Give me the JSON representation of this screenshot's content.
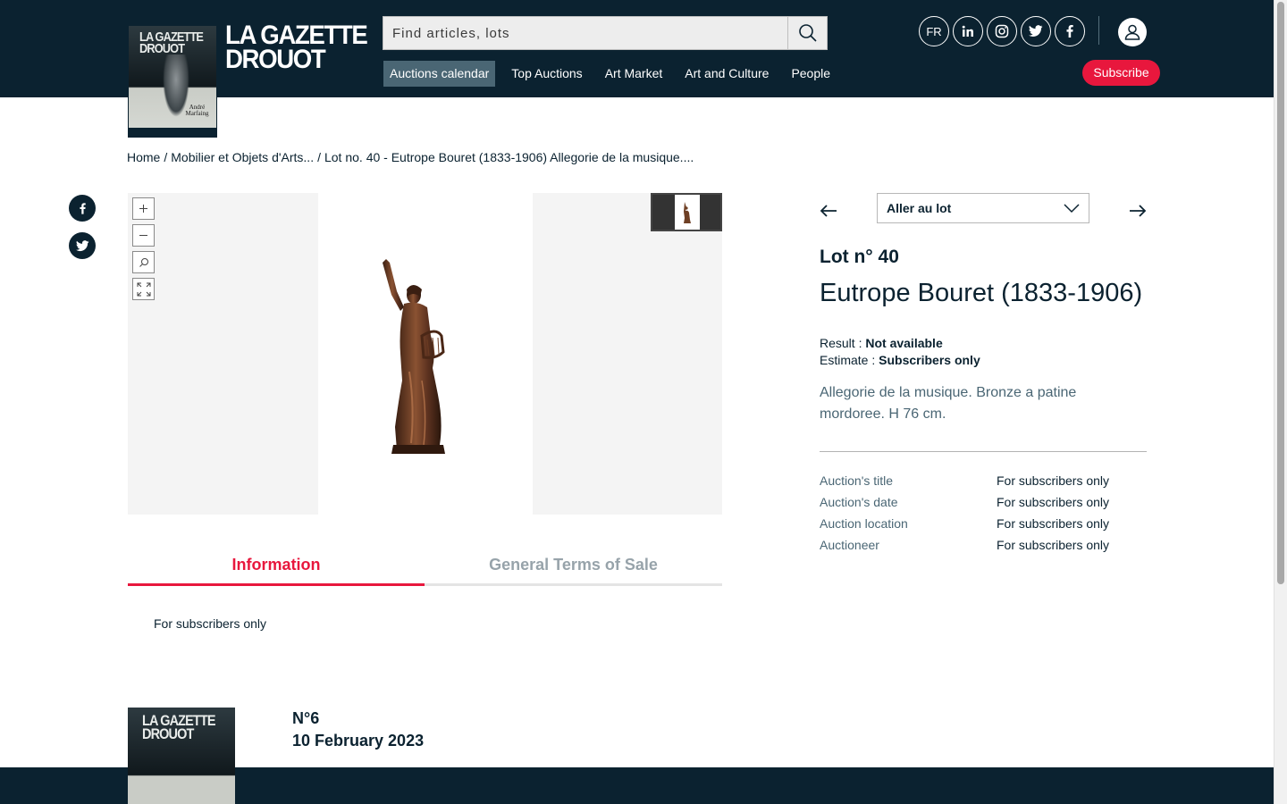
{
  "header": {
    "logo_text_line1": "LA GAZETTE",
    "logo_text_line2": "DROUOT",
    "cover_title_line1": "LA GAZETTE",
    "cover_title_line2": "DROUOT",
    "cover_text": "André Marfaing",
    "search_placeholder": "Find articles, lots",
    "nav": [
      "Auctions calendar",
      "Top Auctions",
      "Art Market",
      "Art and Culture",
      "People"
    ],
    "lang": "FR",
    "subscribe": "Subscribe"
  },
  "breadcrumb": [
    "Home",
    "/",
    "Mobilier et Objets d'Arts...",
    "/",
    "Lot no. 40 - Eutrope Bouret (1833-1906) Allegorie de la musique...."
  ],
  "tabs": {
    "information": "Information",
    "terms": "General Terms of Sale",
    "content": "For subscribers only"
  },
  "lot": {
    "goto_label": "Aller au lot",
    "number": "Lot n° 40",
    "artist": "Eutrope Bouret (1833-1906)",
    "result_label": "Result :",
    "result_value": "Not available",
    "estimate_label": "Estimate :",
    "estimate_value": "Subscribers only",
    "description": "Allegorie de la musique. Bronze a patine mordoree. H 76 cm.",
    "info": [
      {
        "label": "Auction's title",
        "value": "For subscribers only"
      },
      {
        "label": "Auction's date",
        "value": "For subscribers only"
      },
      {
        "label": "Auction location",
        "value": "For subscribers only"
      },
      {
        "label": "Auctioneer",
        "value": "For subscribers only"
      }
    ]
  },
  "issue": {
    "cover_title_line1": "LA GAZETTE",
    "cover_title_line2": "DROUOT",
    "number": "N°6",
    "date": "10 February 2023"
  },
  "colors": {
    "navy": "#0b2230",
    "accent_red": "#e8173d",
    "slate": "#4a6674"
  }
}
